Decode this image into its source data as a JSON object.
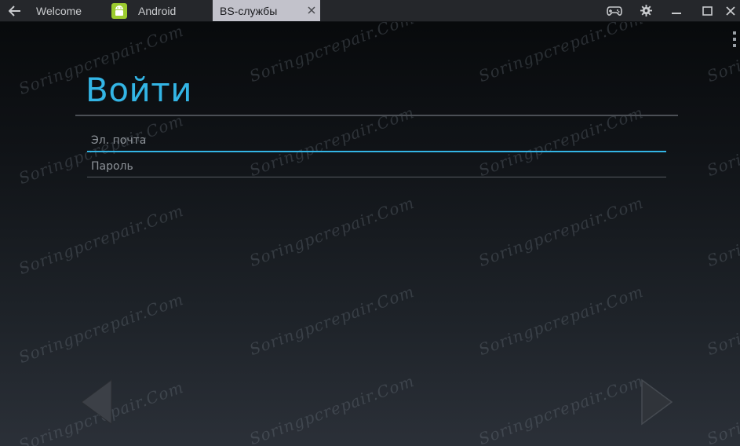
{
  "tabs": {
    "welcome": "Welcome",
    "android": "Android",
    "bs_services": "BS-службы"
  },
  "icons": {
    "back": "arrow-left-icon",
    "android": "android-robot-icon",
    "close": "close-icon",
    "gamepad": "gamepad-icon",
    "settings": "gear-icon",
    "minimize": "minimize-icon",
    "maximize": "maximize-icon",
    "window_close": "close-icon",
    "overflow": "three-dots-vertical-icon",
    "prev": "triangle-left-icon",
    "next": "triangle-right-icon"
  },
  "colors": {
    "accent": "#33b5e5",
    "android": "#9ccc2f",
    "active_tab": "#c2c2cb"
  },
  "login": {
    "title": "Войти",
    "email_placeholder": "Эл. почта",
    "password_placeholder": "Пароль"
  },
  "watermark": "Soringpcrepair.Com"
}
